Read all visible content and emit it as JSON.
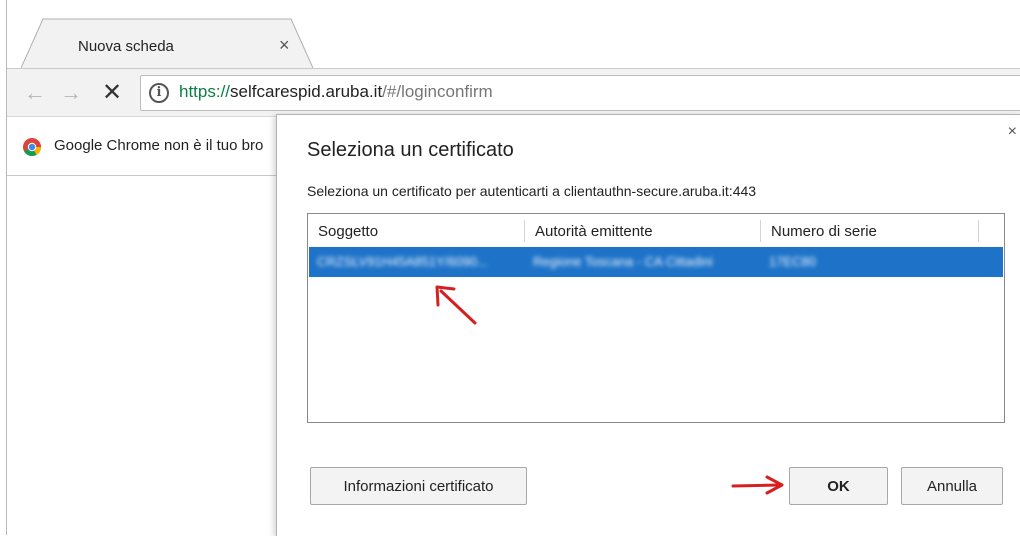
{
  "tab": {
    "title": "Nuova scheda",
    "close_glyph": "×"
  },
  "toolbar": {
    "back_glyph": "←",
    "forward_glyph": "→",
    "stop_glyph": "✕",
    "url_scheme": "https://",
    "url_host": "selfcarespid.aruba.it",
    "url_path": "/#/loginconfirm"
  },
  "infobar": {
    "text": "Google Chrome non è il tuo bro"
  },
  "dialog": {
    "title": "Seleziona un certificato",
    "subtitle": "Seleziona un certificato per autenticarti a clientauthn-secure.aruba.it:443",
    "close_glyph": "×",
    "columns": [
      "Soggetto",
      "Autorità emittente",
      "Numero di serie"
    ],
    "rows": [
      {
        "subject": "CRZSLV91H45A851Y/6090...",
        "issuer": "Regione Toscana - CA Cittadini",
        "serial": "17EC80"
      }
    ],
    "buttons": {
      "info": "Informazioni certificato",
      "ok": "OK",
      "cancel": "Annulla"
    }
  },
  "colors": {
    "selection": "#1e73c8",
    "secure_scheme": "#0b8043",
    "annotation_arrow": "#d42020"
  },
  "icons": [
    "info-icon",
    "chrome-logo-icon",
    "back-arrow-icon",
    "forward-arrow-icon",
    "stop-icon",
    "close-icon"
  ]
}
